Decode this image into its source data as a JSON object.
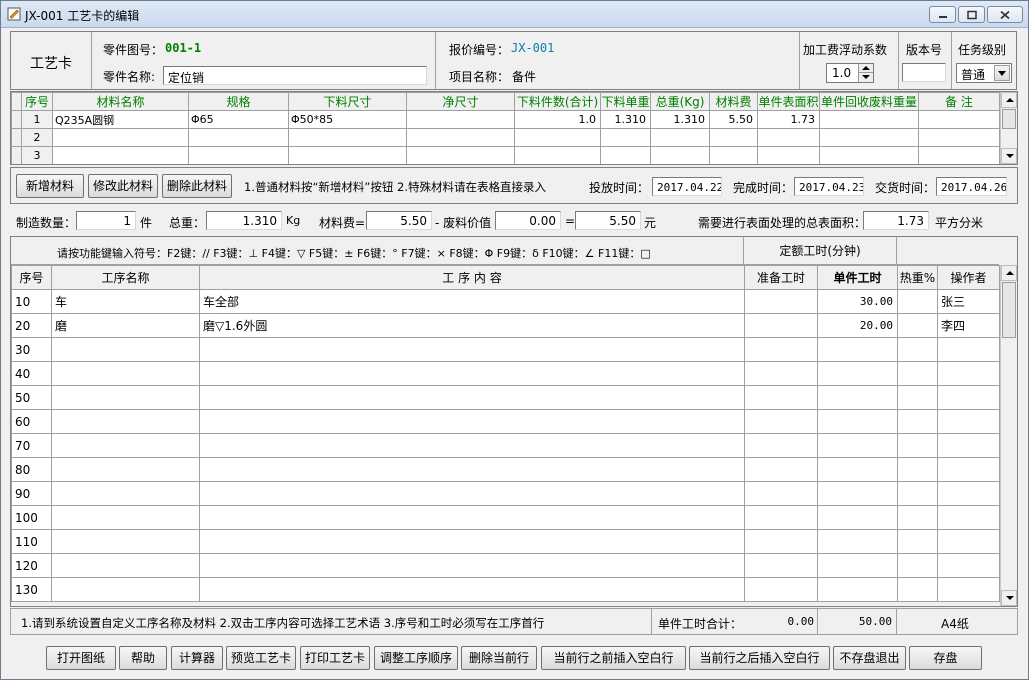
{
  "window": {
    "title": "JX-001 工艺卡的编辑"
  },
  "header": {
    "card_label": "工艺卡",
    "part_drawing_label": "零件图号：",
    "part_drawing_no": "001-1",
    "part_name_label": "零件名称:",
    "part_name_value": "定位销",
    "quote_no_label": "报价编号：",
    "quote_no": "JX-001",
    "project_name_label": "项目名称：",
    "project_name": "备件",
    "float_label": "加工费浮动系数",
    "float_value": "1.0",
    "version_label": "版本号",
    "version_value": "",
    "level_label": "任务级别",
    "level_value": "普通"
  },
  "materials": {
    "columns": [
      "序号",
      "材料名称",
      "规格",
      "下料尺寸",
      "净尺寸",
      "下料件数(合计)",
      "下料单重",
      "总重(Kg)",
      "材料费",
      "单件表面积",
      "单件回收废料重量",
      "备 注"
    ],
    "rows": [
      [
        "1",
        "Q235A圆钢",
        "Φ65",
        "Φ50*85",
        "",
        "1.0",
        "1.310",
        "1.310",
        "5.50",
        "1.73",
        "",
        ""
      ],
      [
        "2",
        "",
        "",
        "",
        "",
        "",
        "",
        "",
        "",
        "",
        "",
        ""
      ],
      [
        "3",
        "",
        "",
        "",
        "",
        "",
        "",
        "",
        "",
        "",
        "",
        ""
      ]
    ]
  },
  "actions": {
    "add_material": "新增材料",
    "edit_material": "修改此材料",
    "delete_material": "删除此材料",
    "hint": "1.普通材料按“新增材料”按钮  2.特殊材料请在表格直接录入",
    "release_label": "投放时间：",
    "release_date": "2017.04.22",
    "finish_label": "完成时间：",
    "finish_date": "2017.04.23",
    "delivery_label": "交货时间：",
    "delivery_date": "2017.04.26"
  },
  "summary": {
    "qty_label": "制造数量：",
    "qty_value": "1",
    "qty_unit": "件",
    "weight_label": "总重：",
    "weight_value": "1.310",
    "weight_unit": "Kg",
    "cost_label": "材料费=",
    "cost_value": "5.50",
    "scrap_label": "- 废料价值",
    "scrap_value": "0.00",
    "eq": "=",
    "net_value": "5.50",
    "net_unit": "元",
    "area_label": "需要进行表面处理的总表面积：",
    "area_value": "1.73",
    "area_unit": "平方分米"
  },
  "process": {
    "fkey_hint": "请按功能键输入符号：F2键：//   F3键：⊥   F4键：▽   F5键：±   F6键：°  F7键：×  F8键：Φ  F9键：δ  F10键：∠  F11键：□",
    "quota_header": "定额工时(分钟)",
    "columns": [
      "序号",
      "工序名称",
      "工  序  内  容",
      "准备工时",
      "单件工时",
      "热重%",
      "操作者"
    ],
    "rows": [
      [
        "10",
        "车",
        "车全部",
        "",
        "30.00",
        "",
        "张三"
      ],
      [
        "20",
        "磨",
        "磨▽1.6外圆",
        "",
        "20.00",
        "",
        "李四"
      ],
      [
        "30",
        "",
        "",
        "",
        "",
        "",
        ""
      ],
      [
        "40",
        "",
        "",
        "",
        "",
        "",
        ""
      ],
      [
        "50",
        "",
        "",
        "",
        "",
        "",
        ""
      ],
      [
        "60",
        "",
        "",
        "",
        "",
        "",
        ""
      ],
      [
        "70",
        "",
        "",
        "",
        "",
        "",
        ""
      ],
      [
        "80",
        "",
        "",
        "",
        "",
        "",
        ""
      ],
      [
        "90",
        "",
        "",
        "",
        "",
        "",
        ""
      ],
      [
        "100",
        "",
        "",
        "",
        "",
        "",
        ""
      ],
      [
        "110",
        "",
        "",
        "",
        "",
        "",
        ""
      ],
      [
        "120",
        "",
        "",
        "",
        "",
        "",
        ""
      ],
      [
        "130",
        "",
        "",
        "",
        "",
        "",
        ""
      ]
    ]
  },
  "footer": {
    "notes": "1.请到系统设置自定义工序名称及材料   2.双击工序内容可选择工艺术语   3.序号和工时必须写在工序首行",
    "total_label": "单件工时合计：",
    "total_prep": "0.00",
    "total_unit": "50.00",
    "paper": "A4纸"
  },
  "buttons": {
    "open_drawing": "打开图纸",
    "help": "帮助",
    "calculator": "计算器",
    "preview": "预览工艺卡",
    "print": "打印工艺卡",
    "reorder": "调整工序顺序",
    "delete_row": "删除当前行",
    "insert_before": "当前行之前插入空白行",
    "insert_after": "当前行之后插入空白行",
    "exit_nosave": "不存盘退出",
    "save": "存盘"
  }
}
